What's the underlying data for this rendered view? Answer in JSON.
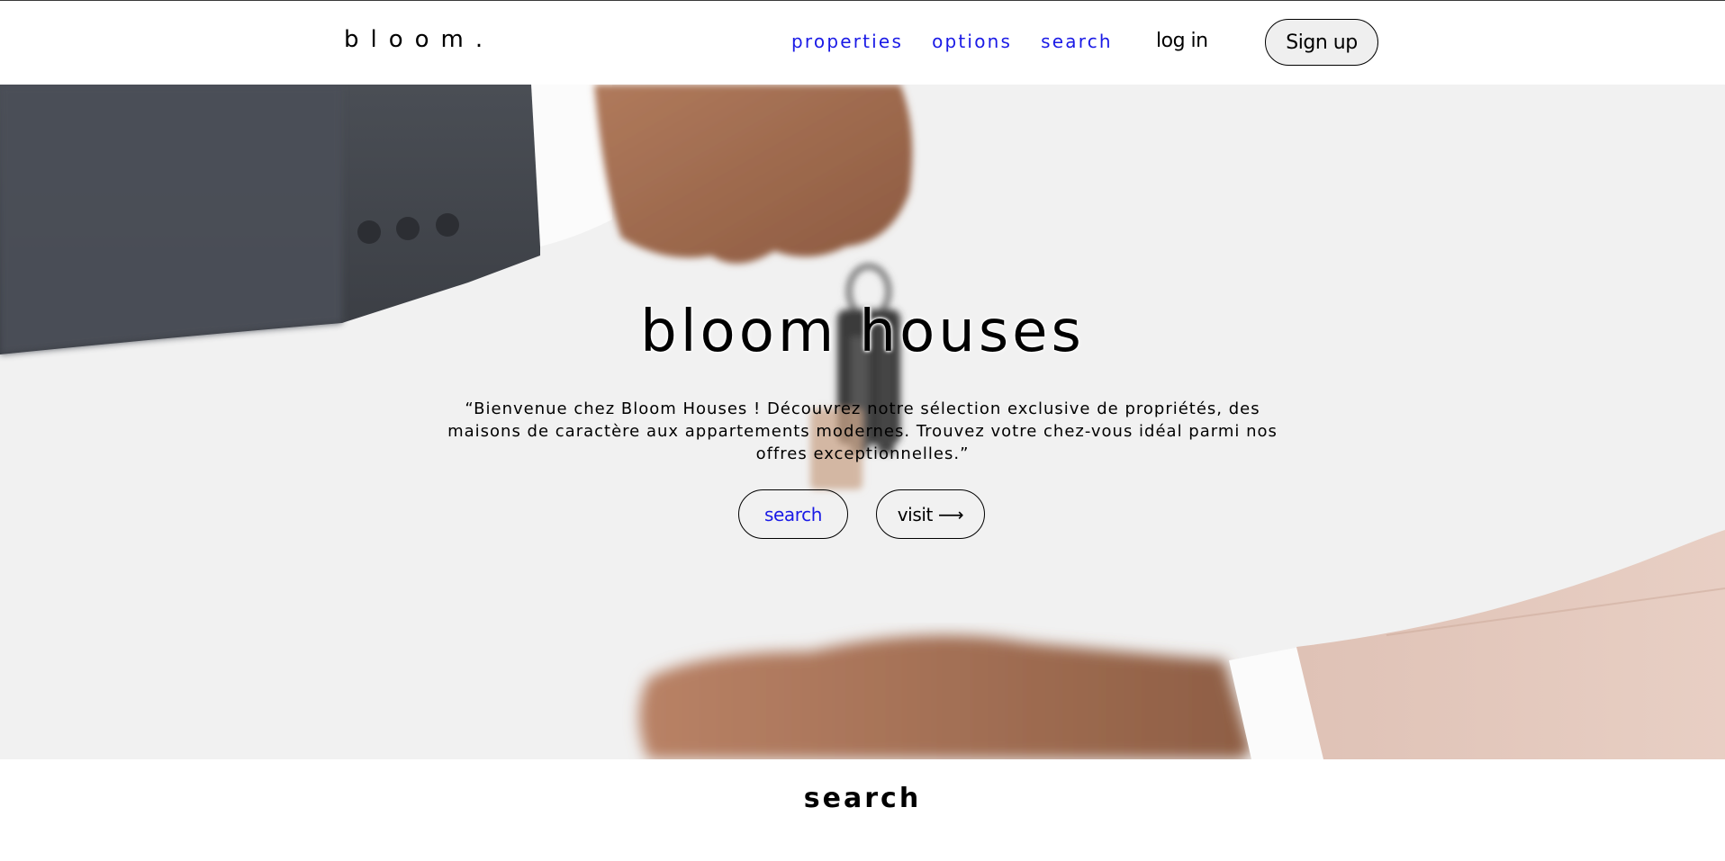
{
  "header": {
    "logo": "bloom.",
    "nav": [
      "properties",
      "options",
      "search"
    ],
    "login_label": "log in",
    "signup_label": "Sign up"
  },
  "hero": {
    "title": "bloom houses",
    "text": "“Bienvenue chez Bloom Houses ! Découvrez notre sélection exclusive de propriétés, des maisons de caractère aux appartements modernes. Trouvez votre chez-vous idéal parmi nos offres exceptionnelles.”",
    "search_label": "search",
    "visit_label": "visit",
    "visit_arrow": "⟶"
  },
  "section": {
    "title": "search"
  },
  "colors": {
    "link": "#1a1ae6",
    "hero_bg": "#f1f1f1",
    "button_bg": "#efefef"
  },
  "icons": {
    "hero_image": "hand-giving-keys-image"
  }
}
